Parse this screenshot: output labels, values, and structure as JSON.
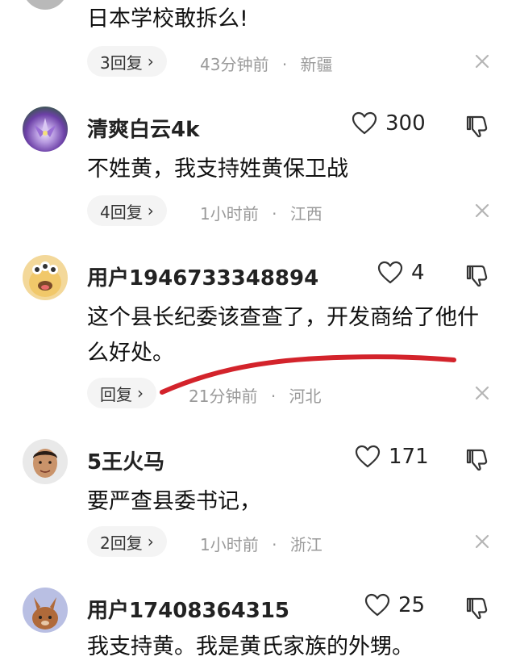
{
  "comments": [
    {
      "text": "日本学校敢拆么!",
      "reply_label": "3回复",
      "time": "43分钟前",
      "location": "新疆"
    },
    {
      "username": "清爽白云4k",
      "likes": "300",
      "text": "不姓黄，我支持姓黄保卫战",
      "reply_label": "4回复",
      "time": "1小时前",
      "location": "江西"
    },
    {
      "username": "用户1946733348894",
      "likes": "4",
      "text": "这个县长纪委该查查了，开发商给了他什么好处。",
      "reply_label": "回复",
      "time": "21分钟前",
      "location": "河北"
    },
    {
      "username": "5王火马",
      "likes": "171",
      "text": "要严查县委书记，",
      "reply_label": "2回复",
      "time": "1小时前",
      "location": "浙江"
    },
    {
      "username": "用户17408364315",
      "likes": "25",
      "text": "我支持黄。我是黄氏家族的外甥。"
    }
  ],
  "separator": "·",
  "chevron": "›",
  "colors": {
    "annotation": "#d3232b",
    "meta": "#9a9a9a",
    "pill_bg": "#f4f4f4"
  }
}
